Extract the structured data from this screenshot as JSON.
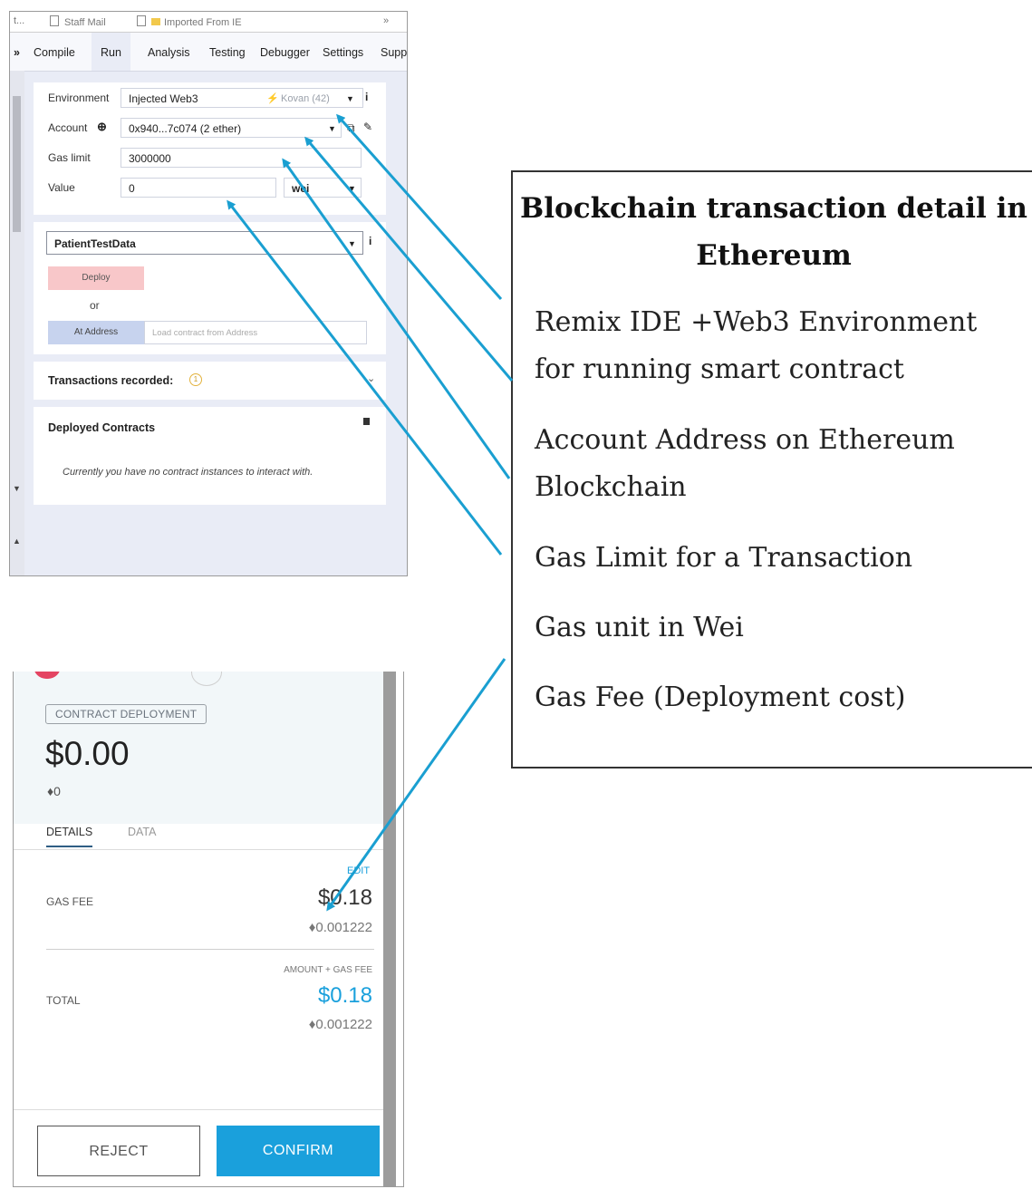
{
  "remix": {
    "bookmarks": {
      "item1": "Staff Mail",
      "item2": "Imported From IE",
      "overflow": "»",
      "left": "t..."
    },
    "tabs": [
      "Compile",
      "Run",
      "Analysis",
      "Testing",
      "Debugger",
      "Settings",
      "Supp"
    ],
    "nav_marker": "»",
    "environment": {
      "label": "Environment",
      "value": "Injected Web3",
      "network": "Kovan (42)"
    },
    "account": {
      "label": "Account",
      "value": "0x940...7c074 (2 ether)"
    },
    "gas_limit": {
      "label": "Gas limit",
      "value": "3000000"
    },
    "value": {
      "label": "Value",
      "amount": "0",
      "unit": "wei"
    },
    "contract": {
      "selected": "PatientTestData",
      "deploy_label": "Deploy",
      "or_label": "or",
      "at_address_label": "At Address",
      "at_address_placeholder": "Load contract from Address"
    },
    "transactions": {
      "label": "Transactions recorded:",
      "count": "1"
    },
    "deployed": {
      "label": "Deployed Contracts",
      "empty_message": "Currently you have no contract instances to interact with."
    }
  },
  "metamask": {
    "badge": "CONTRACT DEPLOYMENT",
    "amount_usd": "$0.00",
    "amount_eth": "0",
    "tabs": [
      "DETAILS",
      "DATA"
    ],
    "edit_label": "EDIT",
    "gas_fee": {
      "label": "GAS FEE",
      "usd": "$0.18",
      "eth": "0.001222"
    },
    "total": {
      "caption": "AMOUNT + GAS FEE",
      "label": "TOTAL",
      "usd": "$0.18",
      "eth": "0.001222"
    },
    "reject_label": "REJECT",
    "confirm_label": "CONFIRM",
    "accent_color": "#1aa0dc"
  },
  "description": {
    "title": "Blockchain transaction detail in Ethereum",
    "items": [
      "Remix IDE +Web3 Environment for running smart contract",
      "Account Address on Ethereum Blockchain",
      "Gas Limit for a Transaction",
      "Gas unit in Wei",
      "Gas Fee (Deployment cost)"
    ]
  },
  "arrow_color": "#1a9fd1"
}
